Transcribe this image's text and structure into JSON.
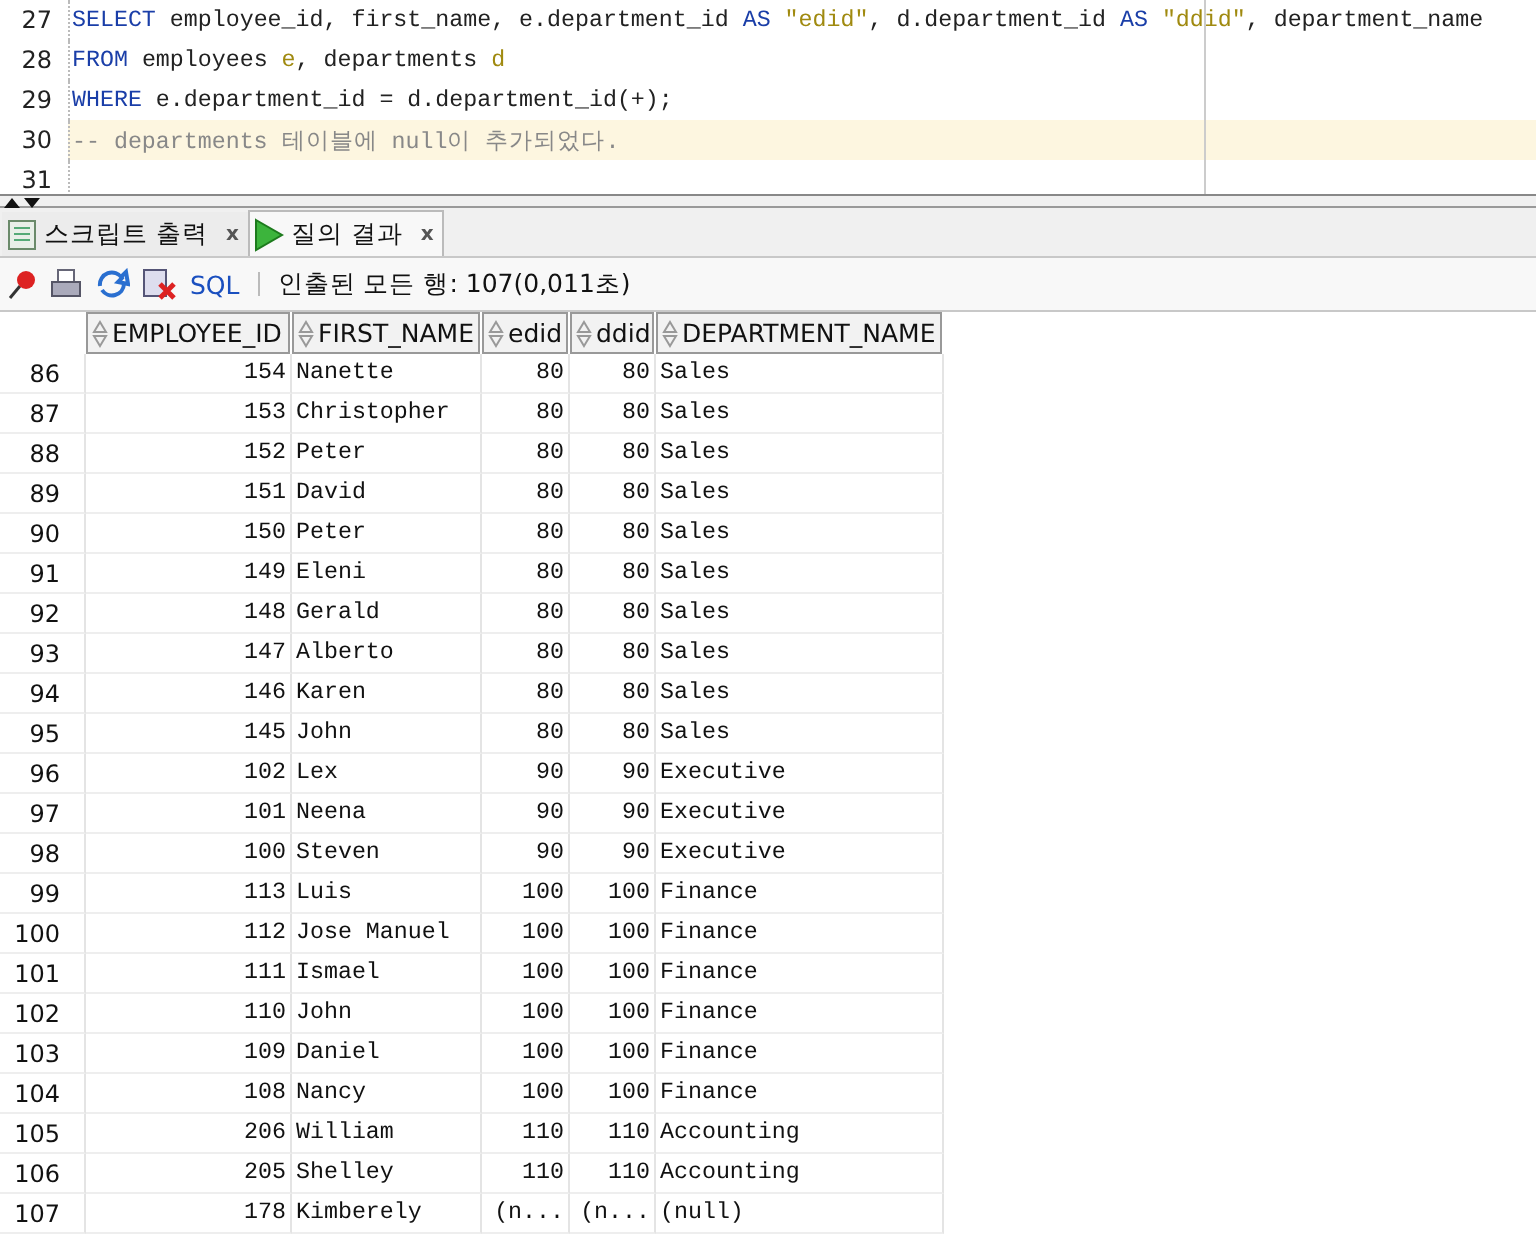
{
  "editor": {
    "lines": [
      {
        "number": "27",
        "current": false,
        "tokens": [
          {
            "kind": "keyword",
            "text": "SELECT"
          },
          {
            "kind": "plain",
            "text": " employee_id, first_name, e.department_id "
          },
          {
            "kind": "keyword",
            "text": "AS"
          },
          {
            "kind": "string",
            "text": " \"edid\""
          },
          {
            "kind": "plain",
            "text": ", d.department_id "
          },
          {
            "kind": "keyword",
            "text": "AS"
          },
          {
            "kind": "string",
            "text": " \"ddid\""
          },
          {
            "kind": "plain",
            "text": ", department_name"
          }
        ]
      },
      {
        "number": "28",
        "current": false,
        "tokens": [
          {
            "kind": "keyword",
            "text": "FROM"
          },
          {
            "kind": "plain",
            "text": " employees "
          },
          {
            "kind": "string",
            "text": "e"
          },
          {
            "kind": "plain",
            "text": ", departments "
          },
          {
            "kind": "string",
            "text": "d"
          }
        ]
      },
      {
        "number": "29",
        "current": false,
        "tokens": [
          {
            "kind": "keyword",
            "text": "WHERE"
          },
          {
            "kind": "plain",
            "text": " e.department_id = d.department_id(+);"
          }
        ]
      },
      {
        "number": "30",
        "current": true,
        "tokens": [
          {
            "kind": "comment",
            "text": "-- departments 테이블에 null이 추가되었다."
          }
        ]
      },
      {
        "number": "31",
        "current": false
      }
    ]
  },
  "tabs": [
    {
      "label": "스크립트 출력",
      "close": "x",
      "kind": "script",
      "selected": false
    },
    {
      "label": "질의 결과",
      "close": "x",
      "kind": "query",
      "selected": true
    }
  ],
  "toolbar": {
    "sql_link": "SQL",
    "status": "인출된 모든 행: 107(0,011초)"
  },
  "grid": {
    "columns": [
      "",
      "EMPLOYEE_ID",
      "FIRST_NAME",
      "edid",
      "ddid",
      "DEPARTMENT_NAME"
    ],
    "rows": [
      [
        "86",
        "154",
        "Nanette",
        "80",
        "80",
        "Sales"
      ],
      [
        "87",
        "153",
        "Christopher",
        "80",
        "80",
        "Sales"
      ],
      [
        "88",
        "152",
        "Peter",
        "80",
        "80",
        "Sales"
      ],
      [
        "89",
        "151",
        "David",
        "80",
        "80",
        "Sales"
      ],
      [
        "90",
        "150",
        "Peter",
        "80",
        "80",
        "Sales"
      ],
      [
        "91",
        "149",
        "Eleni",
        "80",
        "80",
        "Sales"
      ],
      [
        "92",
        "148",
        "Gerald",
        "80",
        "80",
        "Sales"
      ],
      [
        "93",
        "147",
        "Alberto",
        "80",
        "80",
        "Sales"
      ],
      [
        "94",
        "146",
        "Karen",
        "80",
        "80",
        "Sales"
      ],
      [
        "95",
        "145",
        "John",
        "80",
        "80",
        "Sales"
      ],
      [
        "96",
        "102",
        "Lex",
        "90",
        "90",
        "Executive"
      ],
      [
        "97",
        "101",
        "Neena",
        "90",
        "90",
        "Executive"
      ],
      [
        "98",
        "100",
        "Steven",
        "90",
        "90",
        "Executive"
      ],
      [
        "99",
        "113",
        "Luis",
        "100",
        "100",
        "Finance"
      ],
      [
        "100",
        "112",
        "Jose Manuel",
        "100",
        "100",
        "Finance"
      ],
      [
        "101",
        "111",
        "Ismael",
        "100",
        "100",
        "Finance"
      ],
      [
        "102",
        "110",
        "John",
        "100",
        "100",
        "Finance"
      ],
      [
        "103",
        "109",
        "Daniel",
        "100",
        "100",
        "Finance"
      ],
      [
        "104",
        "108",
        "Nancy",
        "100",
        "100",
        "Finance"
      ],
      [
        "105",
        "206",
        "William",
        "110",
        "110",
        "Accounting"
      ],
      [
        "106",
        "205",
        "Shelley",
        "110",
        "110",
        "Accounting"
      ],
      [
        "107",
        "178",
        "Kimberely",
        "(n...",
        "(n...",
        "(null)"
      ]
    ]
  }
}
